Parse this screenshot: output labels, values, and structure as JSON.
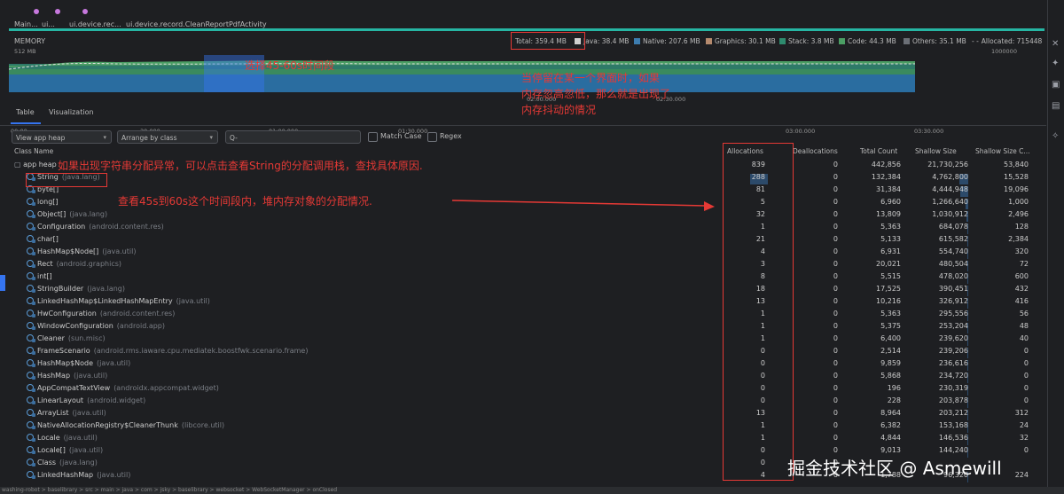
{
  "timeline": {
    "labels": [
      "Main...",
      "ui...",
      "ui.device.rec...",
      "ui.device.record.CleanReportPdfActivity"
    ]
  },
  "memory": {
    "title": "MEMORY",
    "scale_left": "512 MB",
    "scale_right": "1000000",
    "total": "Total: 359.4 MB",
    "legend": [
      {
        "label": "Java: 38.4 MB",
        "color": "#d0d0d0"
      },
      {
        "label": "Native: 207.6 MB",
        "color": "#3d7db0"
      },
      {
        "label": "Graphics: 30.1 MB",
        "color": "#b58a6e"
      },
      {
        "label": "Stack: 3.8 MB",
        "color": "#2e8b6e"
      },
      {
        "label": "Code: 44.3 MB",
        "color": "#4b9e64"
      },
      {
        "label": "Others: 35.1 MB",
        "color": "#6b6f76"
      },
      {
        "label": "Allocated: 715448",
        "color": "#bbbbbb"
      }
    ],
    "axis": [
      "00:00",
      "30.000",
      "01:00.000",
      "01:30.000",
      "02:00.000",
      "02:30.000",
      "03:00.000",
      "03:30.000"
    ]
  },
  "tabs": [
    "Table",
    "Visualization"
  ],
  "controls": {
    "heap": "View app heap",
    "arrange": "Arrange by class",
    "search_placeholder": "Q-",
    "match_case": "Match Case",
    "regex": "Regex"
  },
  "table": {
    "columns": [
      "Class Name",
      "Allocations",
      "Deallocations",
      "Total Count",
      "Shallow Size",
      "Shallow Size C..."
    ],
    "rows": [
      {
        "name": "app heap",
        "pkg": "",
        "alloc": "839",
        "dealloc": "0",
        "total": "442,856",
        "shallow": "21,730,256",
        "shallow_c": "53,840"
      },
      {
        "name": "String",
        "pkg": "(java.lang)",
        "alloc": "288",
        "dealloc": "0",
        "total": "132,384",
        "shallow": "4,762,800",
        "shallow_c": "15,528"
      },
      {
        "name": "byte[]",
        "pkg": "",
        "alloc": "81",
        "dealloc": "0",
        "total": "31,384",
        "shallow": "4,444,948",
        "shallow_c": "19,096"
      },
      {
        "name": "long[]",
        "pkg": "",
        "alloc": "5",
        "dealloc": "0",
        "total": "6,960",
        "shallow": "1,266,640",
        "shallow_c": "1,000"
      },
      {
        "name": "Object[]",
        "pkg": "(java.lang)",
        "alloc": "32",
        "dealloc": "0",
        "total": "13,809",
        "shallow": "1,030,912",
        "shallow_c": "2,496"
      },
      {
        "name": "Configuration",
        "pkg": "(android.content.res)",
        "alloc": "1",
        "dealloc": "0",
        "total": "5,363",
        "shallow": "684,078",
        "shallow_c": "128"
      },
      {
        "name": "char[]",
        "pkg": "",
        "alloc": "21",
        "dealloc": "0",
        "total": "5,133",
        "shallow": "615,582",
        "shallow_c": "2,384"
      },
      {
        "name": "HashMap$Node[]",
        "pkg": "(java.util)",
        "alloc": "4",
        "dealloc": "0",
        "total": "6,931",
        "shallow": "554,740",
        "shallow_c": "320"
      },
      {
        "name": "Rect",
        "pkg": "(android.graphics)",
        "alloc": "3",
        "dealloc": "0",
        "total": "20,021",
        "shallow": "480,504",
        "shallow_c": "72"
      },
      {
        "name": "int[]",
        "pkg": "",
        "alloc": "8",
        "dealloc": "0",
        "total": "5,515",
        "shallow": "478,020",
        "shallow_c": "600"
      },
      {
        "name": "StringBuilder",
        "pkg": "(java.lang)",
        "alloc": "18",
        "dealloc": "0",
        "total": "17,525",
        "shallow": "390,451",
        "shallow_c": "432"
      },
      {
        "name": "LinkedHashMap$LinkedHashMapEntry",
        "pkg": "(java.util)",
        "alloc": "13",
        "dealloc": "0",
        "total": "10,216",
        "shallow": "326,912",
        "shallow_c": "416"
      },
      {
        "name": "HwConfiguration",
        "pkg": "(android.content.res)",
        "alloc": "1",
        "dealloc": "0",
        "total": "5,363",
        "shallow": "295,556",
        "shallow_c": "56"
      },
      {
        "name": "WindowConfiguration",
        "pkg": "(android.app)",
        "alloc": "1",
        "dealloc": "0",
        "total": "5,375",
        "shallow": "253,204",
        "shallow_c": "48"
      },
      {
        "name": "Cleaner",
        "pkg": "(sun.misc)",
        "alloc": "1",
        "dealloc": "0",
        "total": "6,400",
        "shallow": "239,620",
        "shallow_c": "40"
      },
      {
        "name": "FrameScenario",
        "pkg": "(android.rms.iaware.cpu.mediatek.boostfwk.scenario.frame)",
        "alloc": "0",
        "dealloc": "0",
        "total": "2,514",
        "shallow": "239,206",
        "shallow_c": "0"
      },
      {
        "name": "HashMap$Node",
        "pkg": "(java.util)",
        "alloc": "0",
        "dealloc": "0",
        "total": "9,859",
        "shallow": "236,616",
        "shallow_c": "0"
      },
      {
        "name": "HashMap",
        "pkg": "(java.util)",
        "alloc": "0",
        "dealloc": "0",
        "total": "5,868",
        "shallow": "234,720",
        "shallow_c": "0"
      },
      {
        "name": "AppCompatTextView",
        "pkg": "(androidx.appcompat.widget)",
        "alloc": "0",
        "dealloc": "0",
        "total": "196",
        "shallow": "230,319",
        "shallow_c": "0"
      },
      {
        "name": "LinearLayout",
        "pkg": "(android.widget)",
        "alloc": "0",
        "dealloc": "0",
        "total": "228",
        "shallow": "203,878",
        "shallow_c": "0"
      },
      {
        "name": "ArrayList",
        "pkg": "(java.util)",
        "alloc": "13",
        "dealloc": "0",
        "total": "8,964",
        "shallow": "203,212",
        "shallow_c": "312"
      },
      {
        "name": "NativeAllocationRegistry$CleanerThunk",
        "pkg": "(libcore.util)",
        "alloc": "1",
        "dealloc": "0",
        "total": "6,382",
        "shallow": "153,168",
        "shallow_c": "24"
      },
      {
        "name": "Locale",
        "pkg": "(java.util)",
        "alloc": "1",
        "dealloc": "0",
        "total": "4,844",
        "shallow": "146,536",
        "shallow_c": "32"
      },
      {
        "name": "Locale[]",
        "pkg": "(java.util)",
        "alloc": "0",
        "dealloc": "0",
        "total": "9,013",
        "shallow": "144,240",
        "shallow_c": "0"
      },
      {
        "name": "Class",
        "pkg": "(java.lang)",
        "alloc": "0",
        "dealloc": "0",
        "total": "",
        "shallow": "",
        "shallow_c": ""
      },
      {
        "name": "LinkedHashMap",
        "pkg": "(java.util)",
        "alloc": "4",
        "dealloc": "0",
        "total": "1,788",
        "shallow": "96,320",
        "shallow_c": "224"
      }
    ]
  },
  "annotations": {
    "select_range": "选择45-60s时间段",
    "jitter": "当停留在某一个界面时，如果\n内存忽高忽低，那么就是出现了\n内存抖动的情况",
    "string_note": "如果出现字符串分配异常，可以点击查看String的分配调用栈，查找具体原因.",
    "alloc_note": "查看45s到60s这个时间段内，堆内存对象的分配情况."
  },
  "statusbar": "washing-robot > baselibrary > src > main > java > com > jsky > baselibrary > websocket > WebSocketManager > onClosed",
  "watermark": "掘金技术社区 @ Asmewill",
  "colors": {
    "accent": "#3574f0",
    "annotation": "#e53935",
    "timeline": "#26b5a3"
  }
}
